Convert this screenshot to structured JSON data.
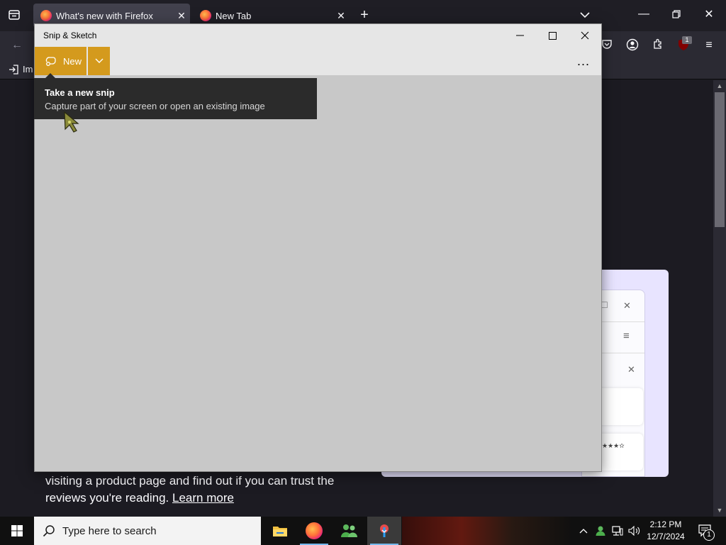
{
  "firefox": {
    "tabs": [
      {
        "label": "What's new with Firefox",
        "active": true
      },
      {
        "label": "New Tab",
        "active": false
      }
    ],
    "bookmarks_partial": "Im",
    "extension_badge": "1",
    "page": {
      "promo_text": "visiting a product page and find out if you can trust the reviews you're reading.",
      "promo_link": "Learn more"
    }
  },
  "snip": {
    "title": "Snip & Sketch",
    "new_label": "New",
    "more_label": "...",
    "tooltip": {
      "title": "Take a new snip",
      "description": "Capture part of your screen or open an existing image"
    }
  },
  "taskbar": {
    "search_placeholder": "Type here to search",
    "time": "2:12 PM",
    "date": "12/7/2024",
    "notification_count": "1"
  },
  "colors": {
    "snip_accent": "#d49a1d",
    "firefox_bg": "#1c1b22",
    "promo_card": "#e8e4ff"
  }
}
